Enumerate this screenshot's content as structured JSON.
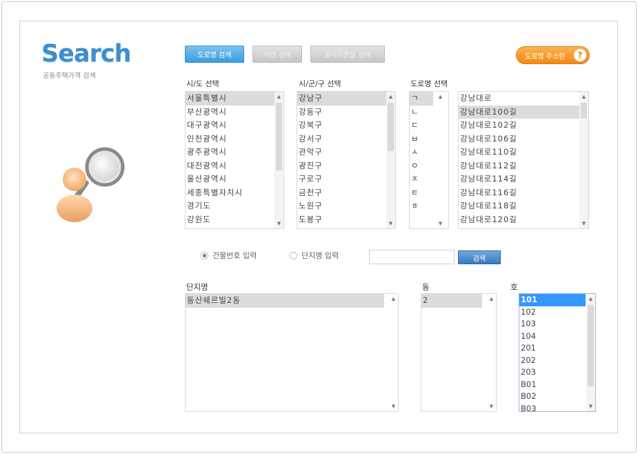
{
  "logo": {
    "title": "Search",
    "subtitle": "공동주택가격 검색"
  },
  "tabs": [
    {
      "label": "도로명 검색",
      "active": true
    },
    {
      "label": "지번 검색",
      "active": false
    },
    {
      "label": "공시기준일 검색",
      "active": false
    }
  ],
  "guide_button": {
    "label": "도로명 주소란",
    "icon": "question-icon",
    "icon_glyph": "?"
  },
  "columns": {
    "sido": {
      "title": "시/도 선택",
      "options": [
        "서울특별시",
        "부산광역시",
        "대구광역시",
        "인천광역시",
        "광주광역시",
        "대전광역시",
        "울산광역시",
        "세종특별자치시",
        "경기도",
        "강원도"
      ]
    },
    "sigungu": {
      "title": "시/군/구 선택",
      "options": [
        "강남구",
        "강동구",
        "강북구",
        "강서구",
        "관악구",
        "광진구",
        "구로구",
        "금천구",
        "노원구",
        "도봉구"
      ]
    },
    "road": {
      "title": "도로명 선택",
      "initials": [
        "ㄱ",
        "ㄴ",
        "ㄷ",
        "ㅂ",
        "ㅅ",
        "ㅇ",
        "ㅈ",
        "ㅌ",
        "ㅎ"
      ],
      "options": [
        "강남대로",
        "강남대로100길",
        "강남대로102길",
        "강남대로106길",
        "강남대로110길",
        "강남대로112길",
        "강남대로114길",
        "강남대로116길",
        "강남대로118길",
        "강남대로120길"
      ]
    }
  },
  "search_mode": {
    "options": [
      {
        "label": "건물번호 입력",
        "checked": true
      },
      {
        "label": "단지명 입력",
        "checked": false
      }
    ],
    "input_value": "",
    "search_label": "검색"
  },
  "results": {
    "complex": {
      "title": "단지명",
      "items": [
        "동산쉐르빌2동"
      ]
    },
    "dong": {
      "title": "동",
      "items": [
        "2"
      ]
    },
    "ho": {
      "title": "호",
      "items": [
        "101",
        "102",
        "103",
        "104",
        "201",
        "202",
        "203",
        "B01",
        "B02",
        "B03"
      ]
    }
  },
  "colors": {
    "accent": "#3a9ddd",
    "guide": "#f08a14",
    "selected": "#3399ff"
  }
}
